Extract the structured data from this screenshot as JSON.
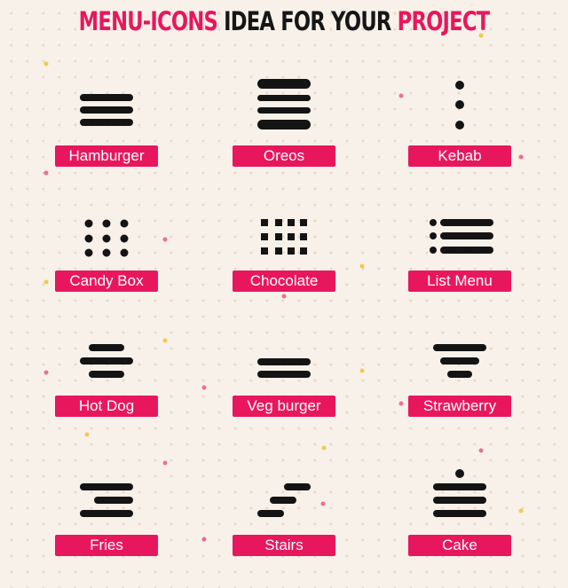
{
  "header": {
    "part1": "MENU-ICONS",
    "part2": "IDEA FOR YOUR",
    "part3": "PROJECT"
  },
  "colors": {
    "accent": "#e8175d",
    "ink": "#141414",
    "background": "#f8f1ea",
    "confetti_yellow": "#f2c94c"
  },
  "items": [
    {
      "label": "Hamburger",
      "icon": "hamburger-icon"
    },
    {
      "label": "Oreos",
      "icon": "oreos-icon"
    },
    {
      "label": "Kebab",
      "icon": "kebab-icon"
    },
    {
      "label": "Candy Box",
      "icon": "candy-box-icon"
    },
    {
      "label": "Chocolate",
      "icon": "chocolate-icon"
    },
    {
      "label": "List Menu",
      "icon": "list-menu-icon"
    },
    {
      "label": "Hot Dog",
      "icon": "hot-dog-icon"
    },
    {
      "label": "Veg burger",
      "icon": "veg-burger-icon"
    },
    {
      "label": "Strawberry",
      "icon": "strawberry-icon"
    },
    {
      "label": "Fries",
      "icon": "fries-icon"
    },
    {
      "label": "Stairs",
      "icon": "stairs-icon"
    },
    {
      "label": "Cake",
      "icon": "cake-icon"
    }
  ]
}
